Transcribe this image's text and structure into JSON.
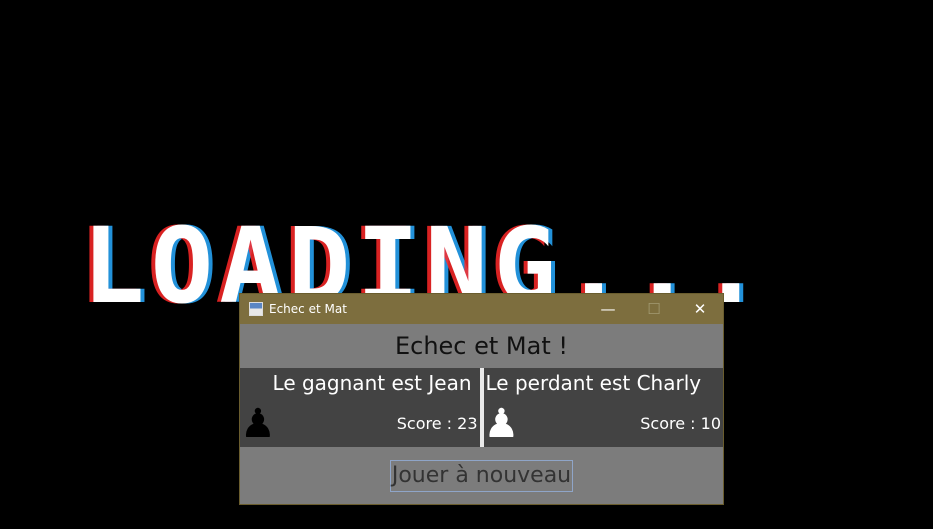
{
  "background": {
    "loading_text": "LOADING..."
  },
  "window": {
    "title": "Echec et Mat",
    "controls": {
      "minimize": "—",
      "maximize": "☐",
      "close": "✕"
    }
  },
  "heading": "Echec et Mat !",
  "winner": {
    "label": "Le gagnant est Jean",
    "score": "Score : 23",
    "piece": "♟"
  },
  "loser": {
    "label": "Le perdant est Charly",
    "score": "Score : 10",
    "piece": "♟"
  },
  "replay_button": "Jouer à nouveau",
  "colors": {
    "titlebar": "#7d6e3e",
    "window_bg": "#7c7c7c",
    "panel_bg": "#434343"
  }
}
